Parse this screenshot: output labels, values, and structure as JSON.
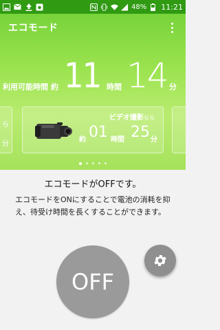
{
  "status_bar": {
    "time": "11:21",
    "battery_percent": "48%",
    "left_icons": [
      "image-icon",
      "mail-icon",
      "upload-icon",
      "camera-icon"
    ],
    "right_icons": [
      "nfc-icon",
      "vibrate-icon",
      "wifi-icon",
      "signal-4g-icon",
      "battery-icon"
    ]
  },
  "app_bar": {
    "title": "エコモード"
  },
  "usage": {
    "label": "利用可能時間",
    "about": "約",
    "hours": "11",
    "hours_unit": "時間",
    "minutes": "14",
    "minutes_unit": "分"
  },
  "cards": {
    "left_partial_1": "ら",
    "left_partial_2": "分",
    "main": {
      "title": "ビデオ撮影",
      "title_suffix": "なら",
      "about": "約",
      "hours": "01",
      "hours_unit": "時間",
      "minutes": "25",
      "minutes_unit": "分"
    }
  },
  "pager": {
    "count": 5,
    "active": 0
  },
  "eco": {
    "heading": "エコモードがOFFです。",
    "description": "エコモードをONにすることで電池の消耗を抑え、待受け時間を長くすることができます。",
    "off_label": "OFF"
  },
  "colors": {
    "status_bar": "#2f9a12",
    "hero_top": "#78d33a",
    "hero_bottom": "#a6e25c",
    "off_button": "#9a9a9a",
    "settings_button": "#8f8f8f"
  }
}
